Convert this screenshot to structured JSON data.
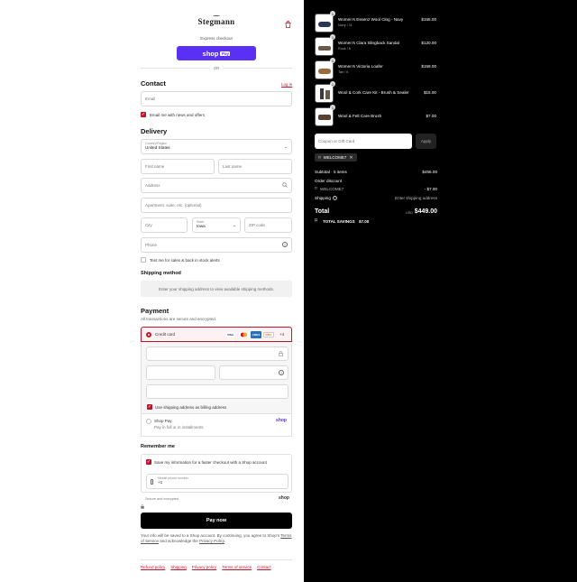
{
  "brand": {
    "logo_text": "Stegmann"
  },
  "express": {
    "label": "Express checkout",
    "shop_pay_text": "shop",
    "shop_pay_badge": "Pay",
    "or_text": "OR"
  },
  "contact": {
    "heading": "Contact",
    "login_link": "Log in",
    "email_placeholder": "Email",
    "news_label": "Email me with news and offers"
  },
  "delivery": {
    "heading": "Delivery",
    "country_label": "Country/Region",
    "country_value": "United States",
    "first_name": "First name",
    "last_name": "Last name",
    "address": "Address",
    "apartment": "Apartment, suite, etc. (optional)",
    "city": "City",
    "state_label": "State",
    "state_value": "Iowa",
    "zip": "ZIP code",
    "phone": "Phone",
    "text_me_label": "Text me for sales & back in stock alerts"
  },
  "shipping": {
    "heading": "Shipping method",
    "note": "Enter your shipping address to view available shipping methods."
  },
  "payment": {
    "heading": "Payment",
    "subtext": "All transactions are secure and encrypted.",
    "credit_card_label": "Credit card",
    "more_cards": "+4",
    "card_brands": [
      "VISA",
      "MC",
      "AMEX",
      "DISC"
    ],
    "billing_label": "Use shipping address as billing address",
    "shop_pay_label": "Shop Pay",
    "shop_pay_sub": "Pay in full or in installments",
    "shop_pay_logo": "shop"
  },
  "remember": {
    "heading": "Remember me",
    "save_label": "Save my information for a faster checkout with a Shop account",
    "mobile_label": "Mobile phone number",
    "mobile_value": "+1",
    "secure_text": "Secure and encrypted",
    "shop_logo": "shop"
  },
  "pay_button": "Pay now",
  "disclaimer": {
    "text1": "Your info will be saved to a Shop account. By continuing, you agree to Shop's",
    "terms": "Terms of Service",
    "text2": "and acknowledge the",
    "privacy": "Privacy Policy",
    "end": "."
  },
  "footer_links": [
    "Refund policy",
    "Shipping",
    "Privacy policy",
    "Terms of service",
    "Contact"
  ],
  "cart": {
    "items": [
      {
        "name": "Women's Essenz Wool Clog - Navy",
        "variant": "Navy / 11",
        "price": "$155.00",
        "qty": "1",
        "swatch": "#2a3550"
      },
      {
        "name": "Women's Clara Slingback Sandal",
        "variant": "Rock / 6",
        "price": "$120.00",
        "qty": "1",
        "swatch": "#6b5a48"
      },
      {
        "name": "Women's Victoria Loafer",
        "variant": "Tan / 6",
        "price": "$159.00",
        "qty": "1",
        "swatch": "#9b6b3e"
      },
      {
        "name": "Wool & Cork Care Kit - Brush & Sealer",
        "variant": "",
        "price": "$15.00",
        "qty": "1",
        "swatch": "#3a3a3a"
      },
      {
        "name": "Wool & Felt Care Brush",
        "variant": "",
        "price": "$7.00",
        "qty": "1",
        "swatch": "#5a4030"
      }
    ],
    "coupon_placeholder": "Coupon or Gift Card",
    "apply_label": "Apply",
    "applied_code": "WELCOME7",
    "subtotal_label": "Subtotal · 5 items",
    "subtotal_value": "$456.00",
    "order_discount_label": "Order discount",
    "discount_code": "WELCOME7",
    "discount_value": "- $7.00",
    "shipping_label": "Shipping",
    "shipping_value": "Enter shipping address",
    "total_label": "Total",
    "currency": "USD",
    "total_value": "$449.00",
    "savings_label": "TOTAL SAVINGS",
    "savings_value": "$7.00"
  },
  "colors": {
    "accent": "#c0152f",
    "shop_pay": "#5a31f4",
    "panel": "#000000"
  }
}
